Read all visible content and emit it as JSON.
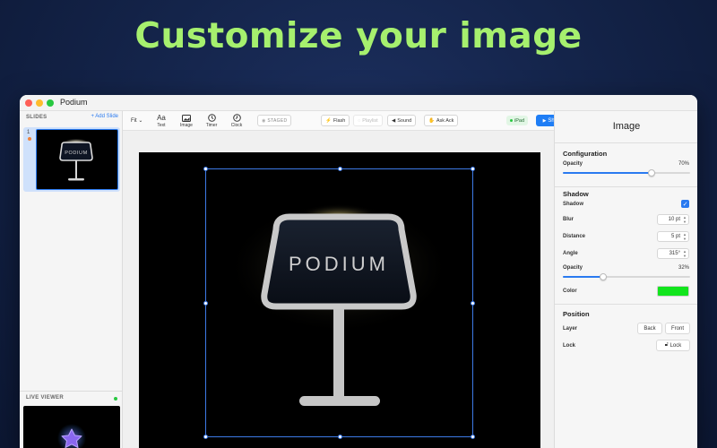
{
  "headline": "Customize your image",
  "window": {
    "title": "Podium"
  },
  "sidebar": {
    "header": "SLIDES",
    "add_label": "+ Add Slide",
    "slides": [
      {
        "number": "1"
      }
    ],
    "live_viewer_label": "LIVE VIEWER"
  },
  "toolbar": {
    "fit_label": "Fit",
    "tools": [
      {
        "label": "Text",
        "icon": "text-icon",
        "glyph": "Aa"
      },
      {
        "label": "Image",
        "icon": "image-icon"
      },
      {
        "label": "Timer",
        "icon": "timer-icon"
      },
      {
        "label": "Clock",
        "icon": "clock-icon"
      }
    ],
    "staged_label": "STAGED",
    "flash_label": "Flash",
    "faded_label": "Playlist",
    "sound_label": "Sound",
    "ask_label": "Ask Ack",
    "device_label": "iPad",
    "show_label": "Show"
  },
  "slide": {
    "sign_text": "PODIUM"
  },
  "inspector": {
    "title": "Image",
    "configuration": {
      "title": "Configuration",
      "opacity_label": "Opacity",
      "opacity_value": "70%",
      "opacity_level": 0.7
    },
    "shadow": {
      "title": "Shadow",
      "shadow_label": "Shadow",
      "shadow_enabled": true,
      "blur_label": "Blur",
      "blur_value": "10 pt",
      "distance_label": "Distance",
      "distance_value": "5 pt",
      "angle_label": "Angle",
      "angle_value": "315°",
      "opacity_label": "Opacity",
      "opacity_value": "32%",
      "opacity_level": 0.32,
      "color_label": "Color",
      "color": "#12e51d"
    },
    "position": {
      "title": "Position",
      "layer_label": "Layer",
      "back_label": "Back",
      "front_label": "Front",
      "lock_label": "Lock",
      "lock_button_label": "Lock"
    }
  },
  "colors": {
    "headline": "#a6f06e",
    "accent": "#1f7ef5",
    "background": "#14244a"
  }
}
